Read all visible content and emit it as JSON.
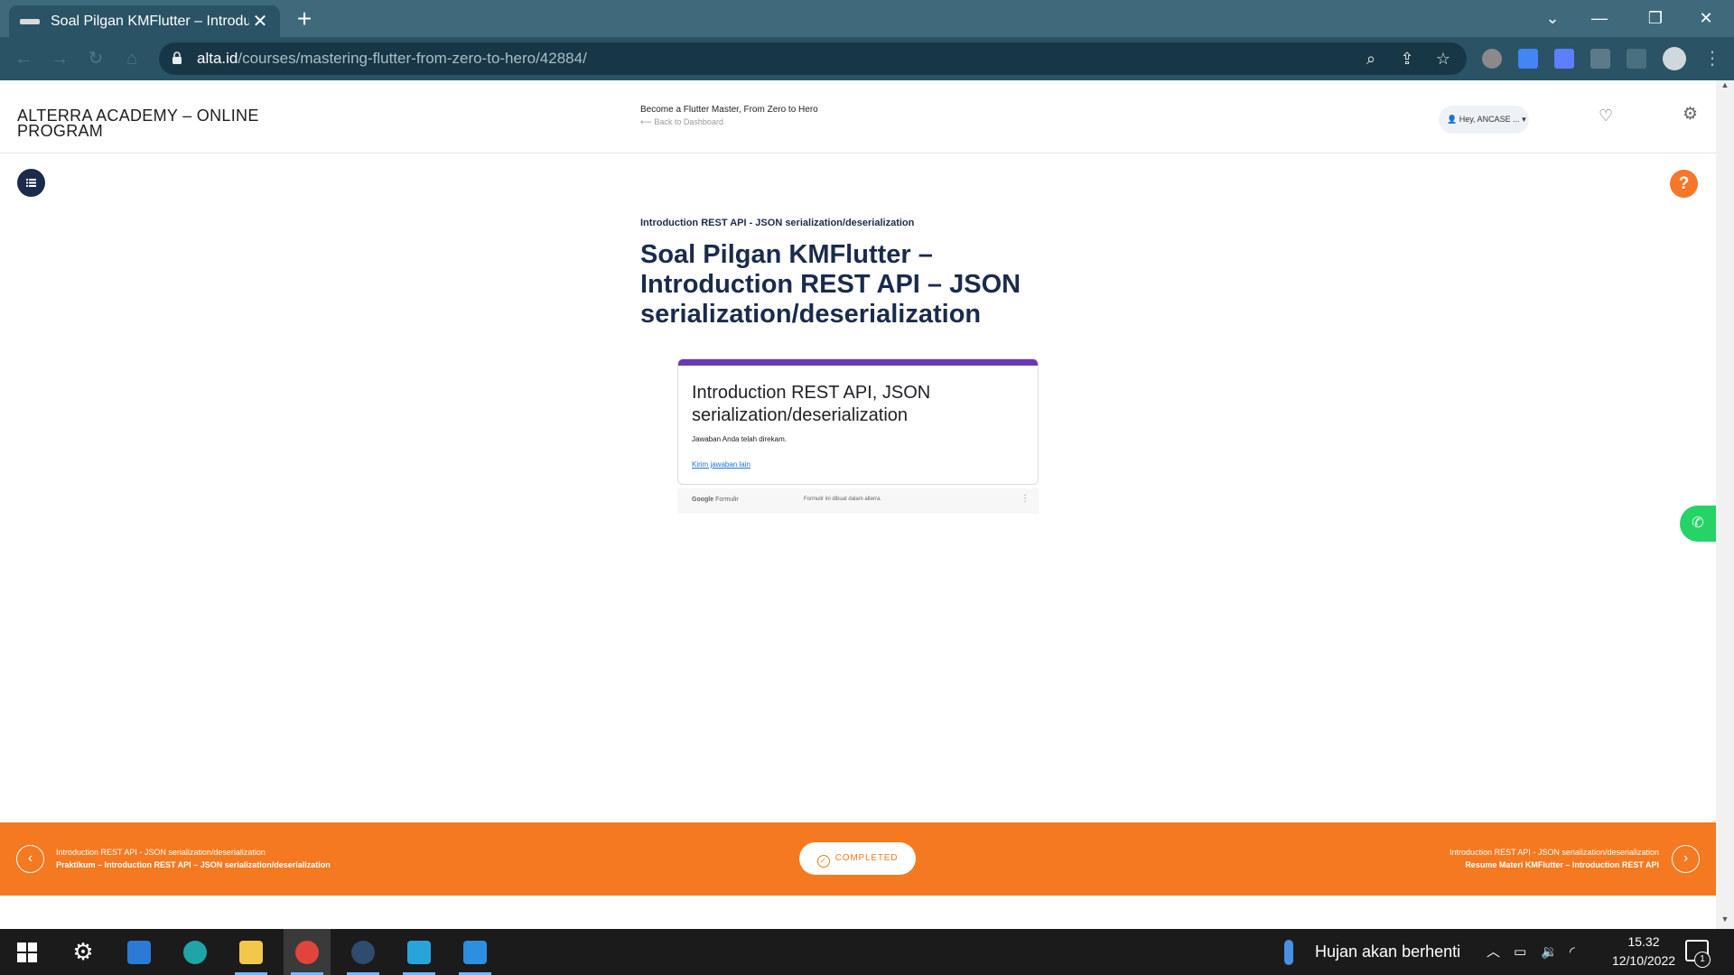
{
  "browser": {
    "tab_title": "Soal Pilgan KMFlutter – Introduct",
    "tab_close": "✕",
    "new_tab": "+",
    "url_host": "alta.id",
    "url_path": "/courses/mastering-flutter-from-zero-to-hero/42884/",
    "window_controls": [
      "⌄",
      "—",
      "❐",
      "✕"
    ]
  },
  "header": {
    "brand": "ALTERRA ACADEMY – ONLINE PROGRAM",
    "course_title": "Become a Flutter Master, From Zero to Hero",
    "back_link": "Back to Dashboard",
    "user_greeting": "Hey, ANCASE ..."
  },
  "lesson": {
    "topic": "Introduction REST API - JSON serialization/deserialization",
    "title": "Soal Pilgan KMFlutter – Introduction REST API – JSON serialization/deserialization"
  },
  "form": {
    "heading": "Introduction REST API, JSON serialization/deserialization",
    "message": "Jawaban Anda telah direkam.",
    "link": "Kirim jawaban lain",
    "footer_brand_google": "Google",
    "footer_brand_forms": "Formulir",
    "footer_note": "Formulir ini dibuat dalam alterra.",
    "more": "⋮"
  },
  "footer_nav": {
    "prev_topic": "Introduction REST API - JSON serialization/deserialization",
    "prev_lesson": "Praktikum – Introduction REST API – JSON serialization/deserialization",
    "completed": "COMPLETED",
    "next_topic": "Introduction REST API - JSON serialization/deserialization",
    "next_lesson": "Resume Materi KMFlutter – Introduction REST API"
  },
  "help": "?",
  "taskbar": {
    "weather": "Hujan akan berhenti",
    "time": "15.32",
    "date": "12/10/2022",
    "notification_count": "1"
  },
  "colors": {
    "navy": "#1a2b4b",
    "orange": "#f47920",
    "form_accent": "#673ab7",
    "whatsapp": "#25d366",
    "chrome_frame": "#3e6a7c"
  }
}
